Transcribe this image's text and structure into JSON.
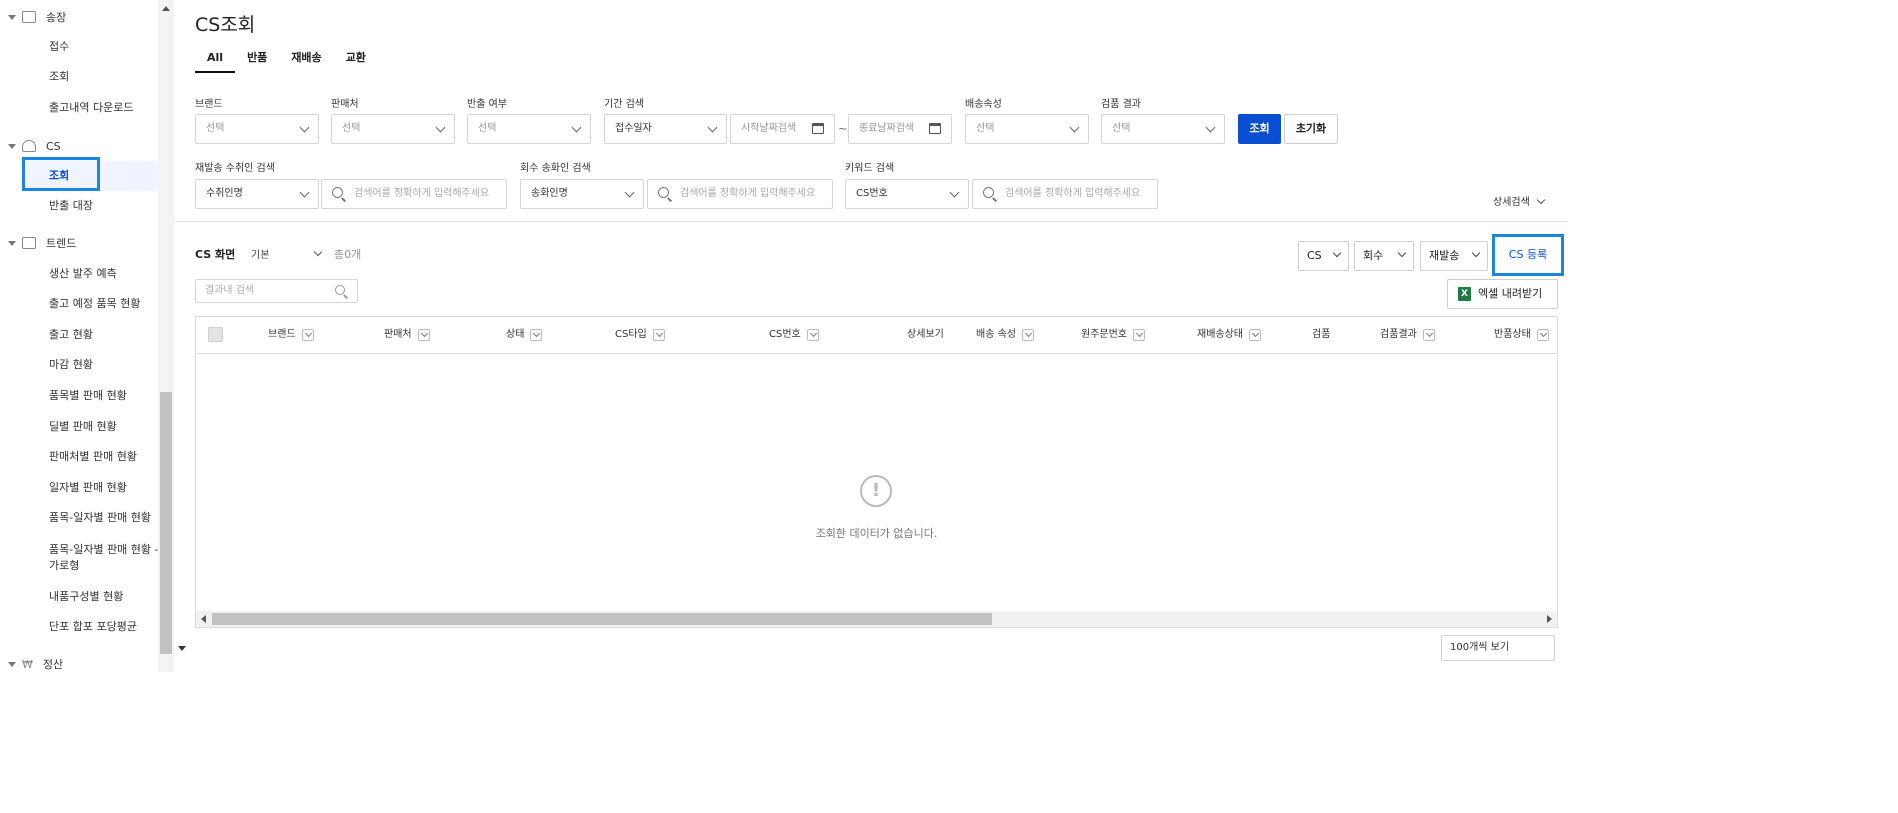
{
  "sidebar": {
    "groups": [
      {
        "label": "송장",
        "items": [
          "접수",
          "조회",
          "출고내역 다운로드"
        ]
      },
      {
        "label": "CS",
        "items": [
          "조회",
          "반출 대장"
        ]
      },
      {
        "label": "트렌드",
        "items": [
          "생산 발주 예측",
          "출고 예정 품목 현황",
          "출고 현황",
          "마감 현황",
          "품목별 판매 현황",
          "딜별 판매 현황",
          "판매처별 판매 현황",
          "일자별 판매 현황",
          "품목-일자별 판매 현황",
          "품목-일자별 판매 현황 - 가로형",
          "내품구성별 현황",
          "단포 합포 포당평균"
        ]
      },
      {
        "label": "정산",
        "items": []
      }
    ]
  },
  "page": {
    "title": "CS조회"
  },
  "tabs": [
    "All",
    "반품",
    "재배송",
    "교환"
  ],
  "filters": {
    "brand": {
      "label": "브랜드",
      "value": "선택"
    },
    "seller": {
      "label": "판매처",
      "value": "선택"
    },
    "export": {
      "label": "반출 여부",
      "value": "선택"
    },
    "period": {
      "label": "기간 검색",
      "value": "접수일자",
      "start_placeholder": "시작날짜검색",
      "end_placeholder": "종료날짜검색",
      "separator": "~"
    },
    "delivery": {
      "label": "배송속성",
      "value": "선택"
    },
    "inspection": {
      "label": "검품 결과",
      "value": "선택"
    },
    "search_button": "조회",
    "reset_button": "초기화",
    "resend": {
      "label": "재발송 수취인 검색",
      "value": "수취인명",
      "placeholder": "검색어를 정확하게 입력해주세요"
    },
    "collect": {
      "label": "회수 송화인 검색",
      "value": "송화인명",
      "placeholder": "검색어를 정확하게 입력해주세요"
    },
    "keyword": {
      "label": "키워드 검색",
      "value": "CS번호",
      "placeholder": "검색어를 정확하게 입력해주세요"
    },
    "detail_search": "상세검색"
  },
  "list": {
    "screen_label": "CS 화면",
    "view_value": "기본",
    "total": "총0개",
    "result_search_placeholder": "결과내 검색",
    "dropdowns": [
      "CS",
      "회수",
      "재발송"
    ],
    "register_button": "CS 등록",
    "excel_button": "엑셀 내려받기",
    "excel_icon": "X",
    "columns": [
      "브랜드",
      "판매처",
      "상태",
      "CS타입",
      "CS번호",
      "상세보기",
      "배송 속성",
      "원주문번호",
      "재배송상태",
      "검품",
      "검품결과",
      "반품상태"
    ],
    "empty_icon": "!",
    "empty_message": "조회한 데이터가 없습니다.",
    "page_size": "100개씩 보기"
  }
}
